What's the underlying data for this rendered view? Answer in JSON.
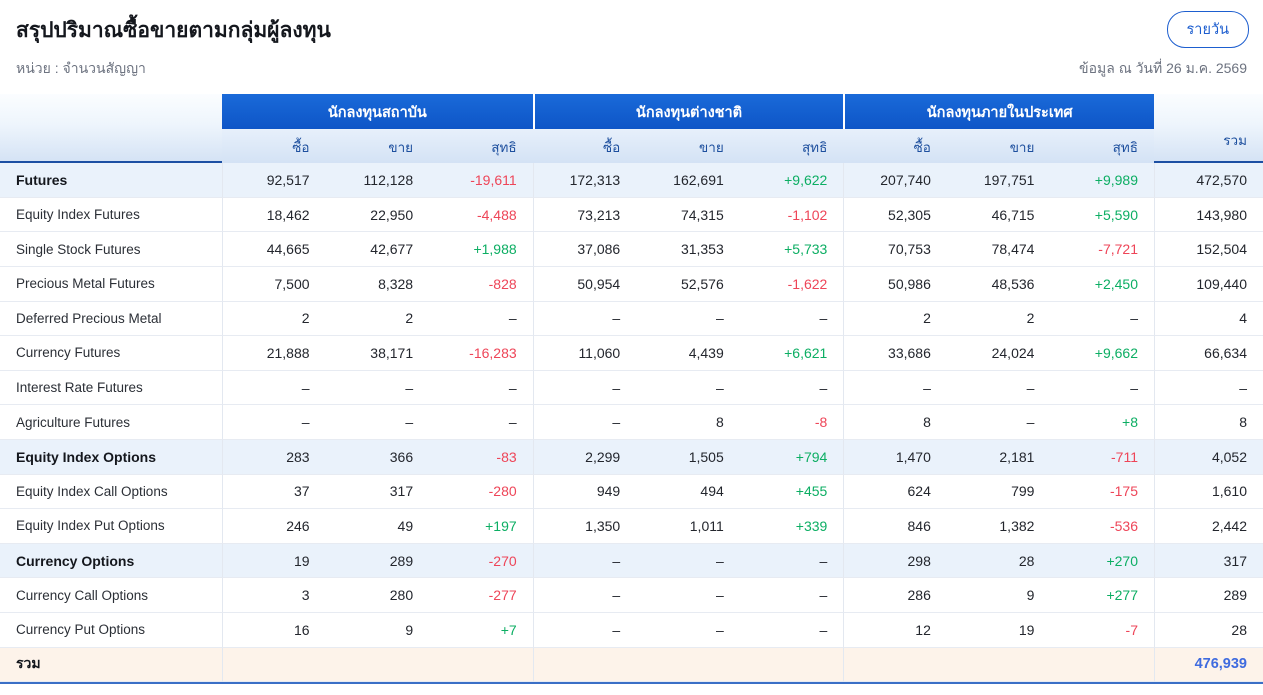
{
  "page": {
    "title": "สรุปปริมาณซื้อขายตามกลุ่มผู้ลงทุน",
    "unit_label": "หน่วย : จำนวนสัญญา",
    "as_of_label": "ข้อมูล ณ วันที่ 26 ม.ค. 2569",
    "period_button_label": "รายวัน"
  },
  "colors": {
    "header_blue": "#1563d2",
    "header_dark_border": "#1c4fa3",
    "subheader_bg": "#d9e6f7",
    "emphasis_row_bg": "#eaf2fb",
    "total_row_bg": "#fdf3ea",
    "negative": "#ee4558",
    "positive": "#0cae63",
    "total_value_blue": "#3f6bdf"
  },
  "table": {
    "groups": [
      {
        "label": "นักลงทุนสถาบัน"
      },
      {
        "label": "นักลงทุนต่างชาติ"
      },
      {
        "label": "นักลงทุนภายในประเทศ"
      }
    ],
    "sub_columns": [
      "ซื้อ",
      "ขาย",
      "สุทธิ"
    ],
    "total_column_label": "รวม",
    "rows": [
      {
        "label": "Futures",
        "emphasis": true,
        "values": [
          "92,517",
          "112,128",
          "-19,611",
          "172,313",
          "162,691",
          "+9,622",
          "207,740",
          "197,751",
          "+9,989"
        ],
        "total": "472,570"
      },
      {
        "label": "Equity Index Futures",
        "values": [
          "18,462",
          "22,950",
          "-4,488",
          "73,213",
          "74,315",
          "-1,102",
          "52,305",
          "46,715",
          "+5,590"
        ],
        "total": "143,980"
      },
      {
        "label": "Single Stock Futures",
        "values": [
          "44,665",
          "42,677",
          "+1,988",
          "37,086",
          "31,353",
          "+5,733",
          "70,753",
          "78,474",
          "-7,721"
        ],
        "total": "152,504"
      },
      {
        "label": "Precious Metal Futures",
        "values": [
          "7,500",
          "8,328",
          "-828",
          "50,954",
          "52,576",
          "-1,622",
          "50,986",
          "48,536",
          "+2,450"
        ],
        "total": "109,440"
      },
      {
        "label": "Deferred Precious Metal",
        "values": [
          "2",
          "2",
          "–",
          "–",
          "–",
          "–",
          "2",
          "2",
          "–"
        ],
        "total": "4"
      },
      {
        "label": "Currency Futures",
        "values": [
          "21,888",
          "38,171",
          "-16,283",
          "11,060",
          "4,439",
          "+6,621",
          "33,686",
          "24,024",
          "+9,662"
        ],
        "total": "66,634"
      },
      {
        "label": "Interest Rate Futures",
        "values": [
          "–",
          "–",
          "–",
          "–",
          "–",
          "–",
          "–",
          "–",
          "–"
        ],
        "total": "–"
      },
      {
        "label": "Agriculture Futures",
        "values": [
          "–",
          "–",
          "–",
          "–",
          "8",
          "-8",
          "8",
          "–",
          "+8"
        ],
        "total": "8"
      },
      {
        "label": "Equity Index Options",
        "emphasis": true,
        "values": [
          "283",
          "366",
          "-83",
          "2,299",
          "1,505",
          "+794",
          "1,470",
          "2,181",
          "-711"
        ],
        "total": "4,052"
      },
      {
        "label": "Equity Index Call Options",
        "values": [
          "37",
          "317",
          "-280",
          "949",
          "494",
          "+455",
          "624",
          "799",
          "-175"
        ],
        "total": "1,610"
      },
      {
        "label": "Equity Index Put Options",
        "values": [
          "246",
          "49",
          "+197",
          "1,350",
          "1,011",
          "+339",
          "846",
          "1,382",
          "-536"
        ],
        "total": "2,442"
      },
      {
        "label": "Currency Options",
        "emphasis": true,
        "values": [
          "19",
          "289",
          "-270",
          "–",
          "–",
          "–",
          "298",
          "28",
          "+270"
        ],
        "total": "317"
      },
      {
        "label": "Currency Call Options",
        "values": [
          "3",
          "280",
          "-277",
          "–",
          "–",
          "–",
          "286",
          "9",
          "+277"
        ],
        "total": "289"
      },
      {
        "label": "Currency Put Options",
        "values": [
          "16",
          "9",
          "+7",
          "–",
          "–",
          "–",
          "12",
          "19",
          "-7"
        ],
        "total": "28"
      },
      {
        "label": "รวม",
        "total_row": true,
        "values": [
          "",
          "",
          "",
          "",
          "",
          "",
          "",
          "",
          ""
        ],
        "total": "476,939"
      }
    ]
  }
}
